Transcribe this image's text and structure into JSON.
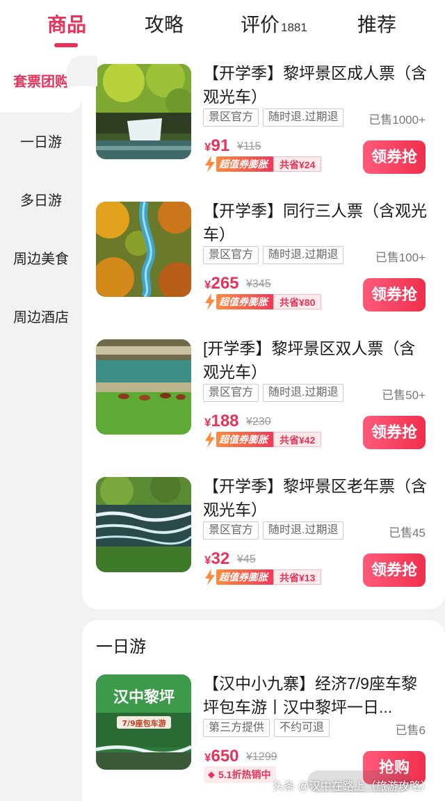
{
  "tabs": [
    {
      "label": "商品",
      "active": true
    },
    {
      "label": "攻略"
    },
    {
      "label": "评价",
      "count": "1881"
    },
    {
      "label": "推荐"
    }
  ],
  "sidebar": {
    "items": [
      {
        "label": "套票团购",
        "active": true
      },
      {
        "label": "一日游"
      },
      {
        "label": "多日游"
      },
      {
        "label": "周边美食"
      },
      {
        "label": "周边酒店"
      }
    ]
  },
  "products": [
    {
      "title": "【开学季】黎坪景区成人票（含观光车）",
      "tags": [
        "景区官方",
        "随时退.过期退"
      ],
      "sold": "已售1000+",
      "price": "91",
      "orig_price": "¥115",
      "coupon_badge": "超值券膨胀",
      "coupon_save": "共省¥24",
      "button": "领券抢"
    },
    {
      "title": "【开学季】同行三人票（含观光车）",
      "tags": [
        "景区官方",
        "随时退.过期退"
      ],
      "sold": "已售100+",
      "price": "265",
      "orig_price": "¥345",
      "coupon_badge": "超值券膨胀",
      "coupon_save": "共省¥80",
      "button": "领券抢"
    },
    {
      "title": "[开学季】黎坪景区双人票（含观光车）",
      "tags": [
        "景区官方",
        "随时退.过期退"
      ],
      "sold": "已售50+",
      "price": "188",
      "orig_price": "¥230",
      "coupon_badge": "超值券膨胀",
      "coupon_save": "共省¥42",
      "button": "领券抢"
    },
    {
      "title": "【开学季】黎坪景区老年票（含观光车）",
      "tags": [
        "景区官方",
        "随时退.过期退"
      ],
      "sold": "已售45",
      "price": "32",
      "orig_price": "¥45",
      "coupon_badge": "超值券膨胀",
      "coupon_save": "共省¥13",
      "button": "领券抢"
    }
  ],
  "day_trip": {
    "section_title": "一日游",
    "product": {
      "title": "【汉中小九寨】经济7/9座车黎坪包车游丨汉中黎坪一日...",
      "tags": [
        "第三方提供",
        "不约可退"
      ],
      "sold": "已售6",
      "price": "650",
      "orig_price": "¥1299",
      "hot_label": "5.1折热销中",
      "button": "抢购",
      "thumb_title": "汉中黎坪",
      "thumb_sub": "7/9座包车游"
    }
  },
  "currency": "¥",
  "watermark": "头条 @汉中在路上（旅游攻略）",
  "colors": {
    "accent": "#e6335a",
    "button_start": "#ff5a7a",
    "button_end": "#ef2f4d"
  }
}
